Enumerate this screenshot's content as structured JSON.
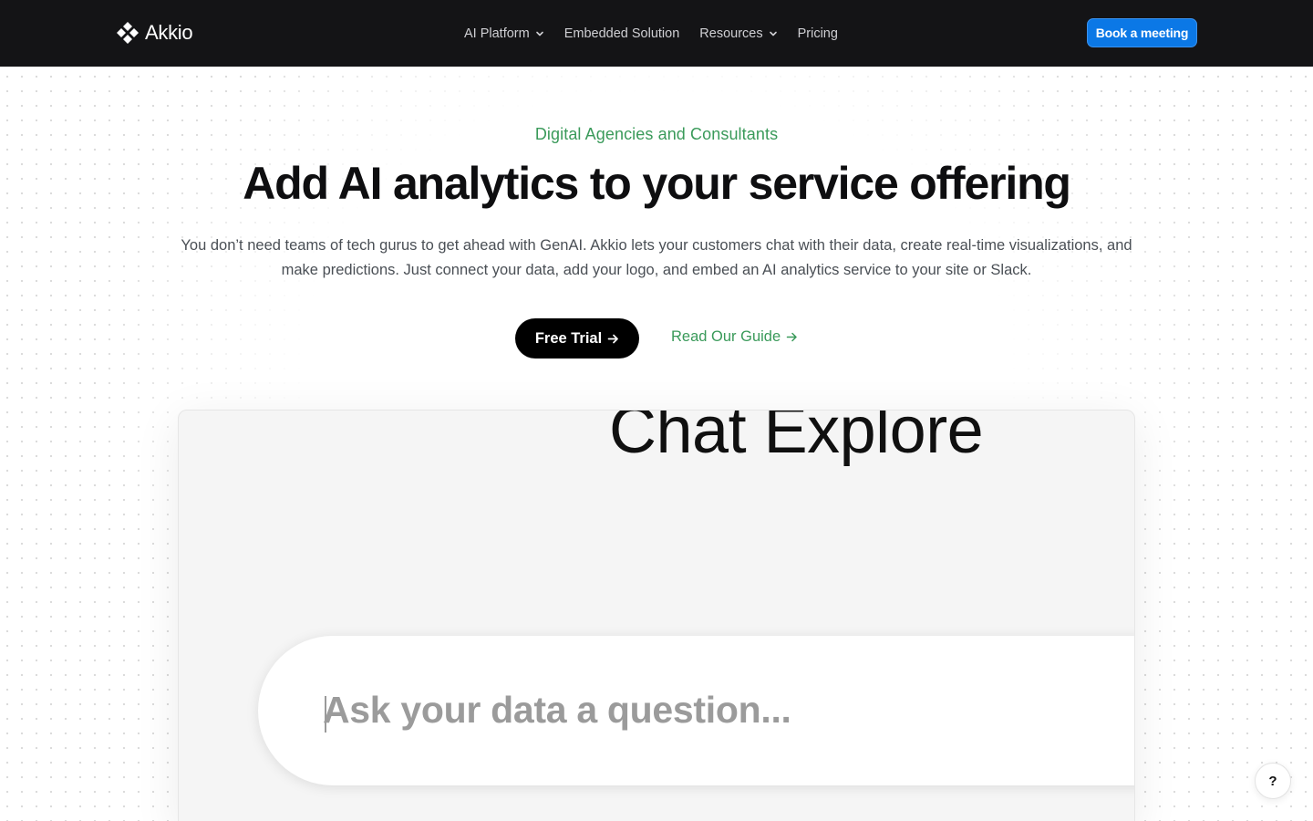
{
  "nav": {
    "brand": "Akkio",
    "items": [
      {
        "label": "AI Platform",
        "has_dropdown": true
      },
      {
        "label": "Embedded Solution",
        "has_dropdown": false
      },
      {
        "label": "Resources",
        "has_dropdown": true
      },
      {
        "label": "Pricing",
        "has_dropdown": false
      }
    ],
    "cta_label": "Book a meeting"
  },
  "hero": {
    "eyebrow": "Digital Agencies and Consultants",
    "title": "Add AI analytics to your service offering",
    "subtitle": "You don’t need teams of tech gurus to get ahead with GenAI. Akkio lets your customers chat with their data, create real-time visualizations, and make predictions. Just connect your data, add your logo, and embed an AI analytics service to your site or Slack.",
    "primary_cta": "Free Trial",
    "secondary_cta": "Read Our Guide"
  },
  "demo": {
    "heading": "Chat Explore",
    "input_placeholder": "Ask your data a question..."
  },
  "help": {
    "label": "?"
  },
  "colors": {
    "nav_bg": "#141416",
    "accent_blue": "#0b78e6",
    "accent_green": "#3a9a5a",
    "cta_black": "#000000",
    "panel_bg": "#f5f5f5"
  }
}
